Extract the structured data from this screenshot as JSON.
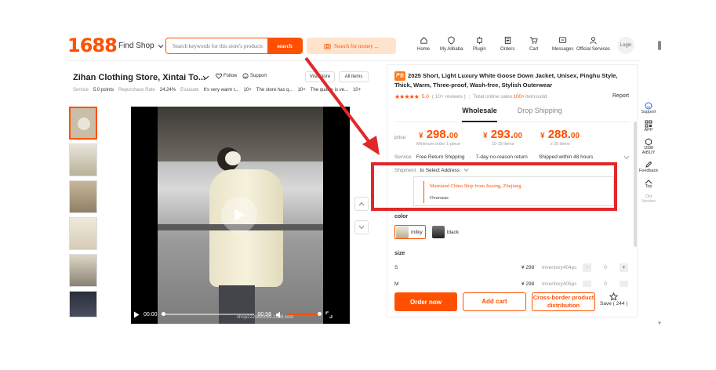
{
  "header": {
    "logo": "1688",
    "find_shop": "Find Shop",
    "search_placeholder": "Search keywords for this store's products",
    "search_button": "search",
    "search_money": "Search for money ...",
    "nav": [
      {
        "label": "Home",
        "icon": "home-icon"
      },
      {
        "label": "My Alibaba",
        "icon": "user-shield-icon"
      },
      {
        "label": "Plugin",
        "icon": "plugin-icon"
      },
      {
        "label": "Orders",
        "icon": "orders-icon"
      },
      {
        "label": "Cart",
        "icon": "cart-icon"
      },
      {
        "label": "Messages",
        "icon": "message-icon"
      },
      {
        "label": "Official Services",
        "icon": "person-icon"
      }
    ],
    "login": "Login"
  },
  "store": {
    "name": "Zihan Clothing Store, Xintai To...",
    "follow": "Follow",
    "support": "Support",
    "visit_store": "Visit store",
    "all_items": "All items",
    "stats": {
      "service_label": "Service",
      "service_value": "5.0 points",
      "repurchase_label": "Repurchase Rate",
      "repurchase_value": "24.24%",
      "evaluate_label": "Evaluate",
      "reviews": [
        "It's very warm t...",
        "10+",
        "The store has q...",
        "10+",
        "The quality is ve...",
        "10+"
      ]
    }
  },
  "video": {
    "time_current": "00:00",
    "time_total": "00:58",
    "watermark": "shop222s65m59.1688.com"
  },
  "product": {
    "tag": "严选",
    "title": "2025 Short, Light Luxury White Goose Down Jacket, Unisex, Pinghu Style, Thick, Warm, Three-proof, Wash-free, Stylish Outerwear",
    "rating": "5.0",
    "reviews": "( 10+ reviews )",
    "sales_label": "Total online sales",
    "sales_value": "100+",
    "sales_unit": "itemssold",
    "report": "Report",
    "tabs": [
      "Wholesale",
      "Drop Shipping"
    ],
    "price_label": "price",
    "prices": [
      {
        "value": "298.",
        "cents": "00",
        "cond": "Minimum order 1 piece"
      },
      {
        "value": "293.",
        "cents": "00",
        "cond": "10-19 items"
      },
      {
        "value": "288.",
        "cents": "00",
        "cond": "≥ 20 items"
      }
    ],
    "currency": "¥",
    "service_label": "Service",
    "services": [
      "Free Return Shipping",
      "·",
      "7-day no-reason return",
      "·",
      "Shipped within 48 hours"
    ],
    "shipment_label": "Shipment",
    "shipment_to": "to Select Address",
    "ship_options": [
      "Mainland China Ship from Jiaxing, Zhejiang",
      "Overseas"
    ],
    "color_label": "color",
    "colors": [
      "milky",
      "black"
    ],
    "size_label": "size",
    "sizes": [
      {
        "size": "S",
        "price": "¥ 298",
        "inventory": "Inventory404pc",
        "qty": "0"
      },
      {
        "size": "M",
        "price": "¥ 298",
        "inventory": "Inventory405pc",
        "qty": "0"
      }
    ],
    "order_now": "Order now",
    "add_cart": "Add cart",
    "cross_border": "Cross-border product distribution",
    "save": "Save ( 244 )"
  },
  "sidebar": [
    {
      "label": "Support",
      "icon": "support-icon"
    },
    {
      "label": "APP",
      "icon": "qr-icon"
    },
    {
      "label": "1688 AIBUY",
      "icon": "aibuy-icon"
    },
    {
      "label": "Feedback",
      "icon": "edit-icon"
    },
    {
      "label": "Top",
      "icon": "chevron-up-icon"
    },
    {
      "label": "Old Version",
      "icon": ""
    }
  ],
  "colors": {
    "accent": "#ff5000",
    "annotation": "#e0282a"
  }
}
